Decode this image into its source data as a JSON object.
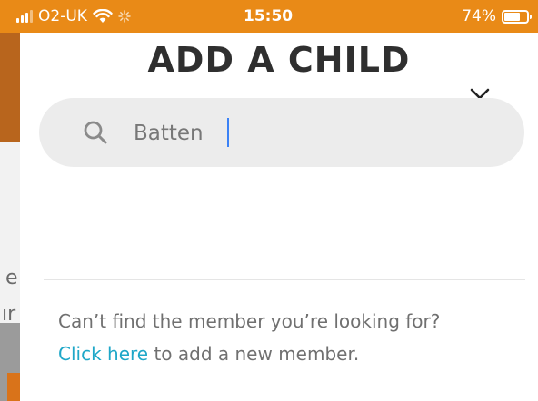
{
  "status_bar": {
    "carrier": "O2-UK",
    "time": "15:50",
    "battery_percent": "74%",
    "battery_level": 0.74,
    "accent_color": "#e98a17"
  },
  "background": {
    "letter_top": "e",
    "letter_bottom": "ır"
  },
  "modal": {
    "title": "ADD A CHILD",
    "close_icon": "close-icon",
    "search": {
      "icon": "search-icon",
      "value": "Batten"
    },
    "help_text": "Can’t find the member you’re looking for?",
    "link_text": "Click here",
    "link_suffix": " to add a new member.",
    "link_color": "#1ea7c8"
  }
}
